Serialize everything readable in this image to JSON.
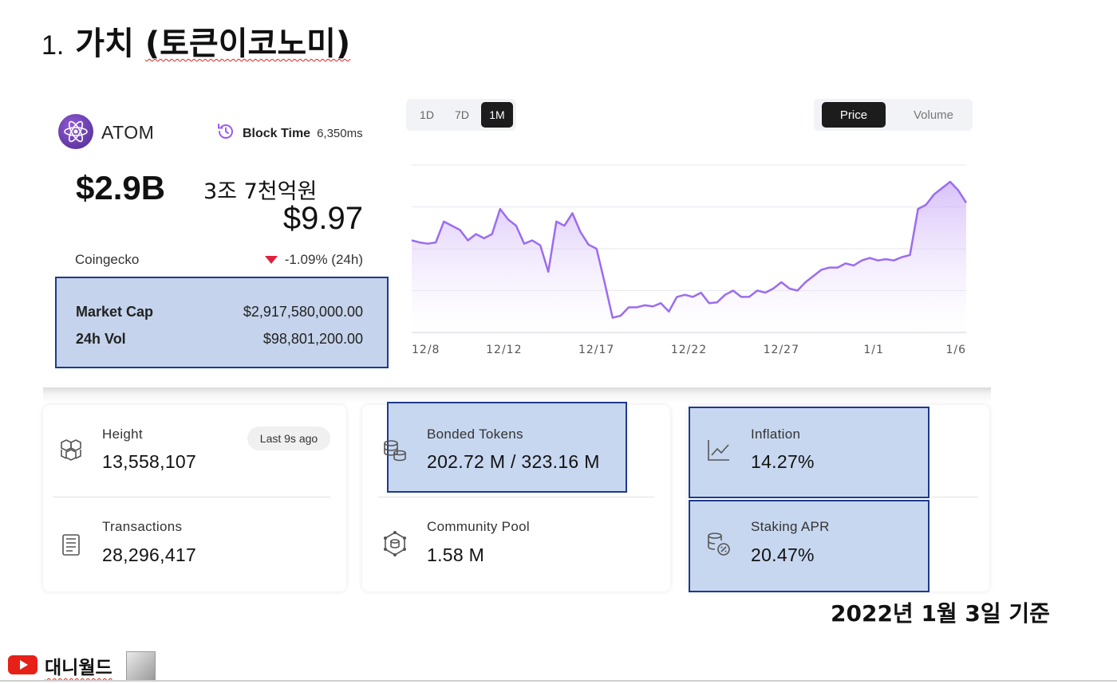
{
  "slide": {
    "number": "1.",
    "title": "가치",
    "title_paren": "(토큰이코노미)"
  },
  "token": {
    "name": "ATOM",
    "block_time_label": "Block Time",
    "block_time_value": "6,350ms",
    "market_cap_short": "$2.9B",
    "krw_note": "3조 7천억원",
    "price": "$9.97",
    "source": "Coingecko",
    "change": "-1.09% (24h)",
    "change_color": "#e0203a",
    "market_cap_label": "Market Cap",
    "market_cap_value": "$2,917,580,000.00",
    "vol_label": "24h Vol",
    "vol_value": "$98,801,200.00"
  },
  "chart_controls": {
    "ranges": [
      "1D",
      "7D",
      "1M"
    ],
    "selected_range": "1M",
    "modes": [
      "Price",
      "Volume"
    ],
    "selected_mode": "Price"
  },
  "chart_data": {
    "type": "area",
    "title": "",
    "xlabel": "",
    "ylabel": "",
    "x_ticks": [
      "12/8",
      "12/12",
      "12/17",
      "12/22",
      "12/27",
      "1/1",
      "1/6"
    ],
    "series_color": "#9b6cf0",
    "grid": true,
    "ylim": [
      0,
      4
    ],
    "values": [
      2.2,
      2.15,
      2.12,
      2.15,
      2.65,
      2.55,
      2.45,
      2.2,
      2.35,
      2.25,
      2.35,
      2.95,
      2.7,
      2.55,
      2.12,
      2.2,
      2.08,
      1.45,
      2.65,
      2.55,
      2.85,
      2.4,
      2.1,
      2.0,
      1.2,
      0.35,
      0.4,
      0.6,
      0.6,
      0.65,
      0.62,
      0.7,
      0.5,
      0.85,
      0.9,
      0.85,
      0.95,
      0.7,
      0.72,
      0.9,
      1.0,
      0.85,
      0.85,
      1.0,
      0.95,
      1.05,
      1.2,
      1.05,
      1.0,
      1.2,
      1.35,
      1.5,
      1.55,
      1.55,
      1.65,
      1.6,
      1.72,
      1.78,
      1.72,
      1.75,
      1.72,
      1.8,
      1.85,
      2.95,
      3.05,
      3.3,
      3.45,
      3.6,
      3.4,
      3.1
    ]
  },
  "metrics": {
    "height_label": "Height",
    "height_value": "13,558,107",
    "height_pill": "Last  9s ago",
    "tx_label": "Transactions",
    "tx_value": "28,296,417",
    "bonded_label": "Bonded Tokens",
    "bonded_value": "202.72 M / 323.16 M",
    "pool_label": "Community Pool",
    "pool_value": "1.58 M",
    "inflation_label": "Inflation",
    "inflation_value": "14.27%",
    "apr_label": "Staking APR",
    "apr_value": "20.47%"
  },
  "footer": {
    "as_of": "2022년 1월 3일 기준",
    "channel": "대니월드"
  },
  "colors": {
    "highlight_fill": "#c5d4ec",
    "highlight_border": "#1f3a8a",
    "accent": "#9b6cf0"
  }
}
